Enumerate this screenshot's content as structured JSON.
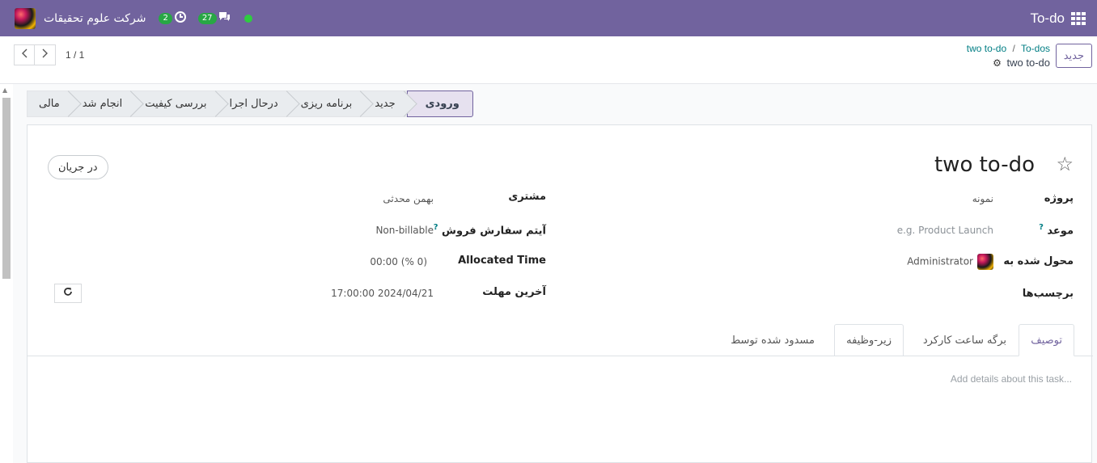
{
  "navbar": {
    "app_name": "To-do",
    "company_name": "شرکت علوم تحقیقات",
    "activity_count": "2",
    "messages_count": "27"
  },
  "control_panel": {
    "new_button": "جدید",
    "breadcrumb": [
      "two to-do",
      "To-dos"
    ],
    "current_record": "two to-do",
    "pager_value": "1 / 1"
  },
  "statusbar": {
    "stages": [
      "ورودی",
      "جدید",
      "برنامه ریزی",
      "درحال اجرا",
      "بررسی کیفیت",
      "انجام شد",
      "مالی"
    ],
    "active_stage": "ورودی"
  },
  "form": {
    "title": "two to-do",
    "state": "در جریان",
    "fields_right": [
      {
        "label": "پروژه",
        "value": "نمونه"
      },
      {
        "label": "موعد",
        "help": "?",
        "placeholder": "e.g. Product Launch"
      },
      {
        "label": "محول شده به",
        "value": "Administrator"
      },
      {
        "label": "برچسب‌ها",
        "value": ""
      }
    ],
    "fields_left": [
      {
        "label": "مشتری",
        "value": "بهمن محدثی"
      },
      {
        "label": "آیتم سفارش فروش",
        "help": "?",
        "value": "Non-billable"
      },
      {
        "label": "Allocated Time",
        "value": "00:00",
        "percent": "(% 0)"
      },
      {
        "label": "آخرین مهلت",
        "value": "17:00:00 2024/04/21"
      }
    ]
  },
  "tabs": [
    "توصیف",
    "برگه ساعت کارکرد",
    "زیر-وظیفه",
    "مسدود شده توسط"
  ],
  "description_placeholder": "Add details about this task...",
  "colors": {
    "brand": "#71639e",
    "link": "#017e84",
    "presence": "#2ecc40",
    "badge": "#28a745"
  },
  "icons": {
    "apps": "grid-icon",
    "star": "star-icon",
    "gear": "gear-icon",
    "refresh": "refresh-icon",
    "pager_prev": "chevron-left-icon",
    "pager_next": "chevron-right-icon",
    "activity": "clock-icon",
    "messages": "chat-icon"
  }
}
